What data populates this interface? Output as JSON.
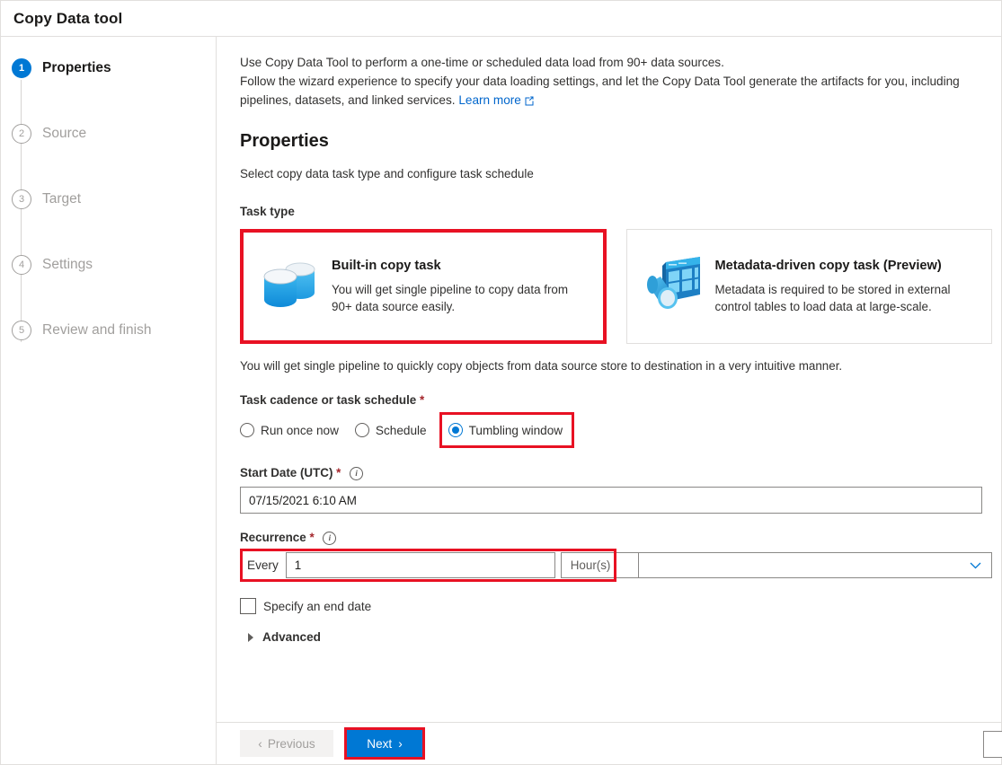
{
  "window": {
    "title": "Copy Data tool"
  },
  "sidebar": {
    "steps": [
      {
        "num": "1",
        "label": "Properties",
        "state": "active"
      },
      {
        "num": "2",
        "label": "Source",
        "state": "inactive"
      },
      {
        "num": "3",
        "label": "Target",
        "state": "inactive"
      },
      {
        "num": "4",
        "label": "Settings",
        "state": "inactive"
      },
      {
        "num": "5",
        "label": "Review and finish",
        "state": "inactive"
      }
    ]
  },
  "intro": {
    "line1": "Use Copy Data Tool to perform a one-time or scheduled data load from 90+ data sources.",
    "line2": "Follow the wizard experience to specify your data loading settings, and let the Copy Data Tool generate the artifacts for you, including pipelines, datasets, and linked services.",
    "learn_more": "Learn more"
  },
  "page": {
    "title": "Properties",
    "subtitle": "Select copy data task type and configure task schedule"
  },
  "task_type": {
    "label": "Task type",
    "cards": [
      {
        "title": "Built-in copy task",
        "desc": "You will get single pipeline to copy data from 90+ data source easily.",
        "icon": "database-copy-icon",
        "selected": true
      },
      {
        "title": "Metadata-driven copy task (Preview)",
        "desc": "Metadata is required to be stored in external control tables to load data at large-scale.",
        "icon": "metadata-table-icon",
        "selected": false
      }
    ],
    "note": "You will get single pipeline to quickly copy objects from data source store to destination in a very intuitive manner."
  },
  "cadence": {
    "label": "Task cadence or task schedule",
    "required_mark": "*",
    "options": [
      {
        "label": "Run once now",
        "checked": false,
        "highlighted": false
      },
      {
        "label": "Schedule",
        "checked": false,
        "highlighted": false
      },
      {
        "label": "Tumbling window",
        "checked": true,
        "highlighted": true
      }
    ]
  },
  "start_date": {
    "label": "Start Date (UTC)",
    "required_mark": "*",
    "info_glyph": "i",
    "value": "07/15/2021 6:10 AM"
  },
  "recurrence": {
    "label": "Recurrence",
    "required_mark": "*",
    "info_glyph": "i",
    "every_label": "Every",
    "value": "1",
    "unit": "Hour(s)",
    "chevron": "⌄"
  },
  "end_date": {
    "label": "Specify an end date",
    "checked": false
  },
  "advanced": {
    "label": "Advanced",
    "expanded": false
  },
  "footer": {
    "previous_label": "Previous",
    "previous_chevron": "‹",
    "next_label": "Next",
    "next_chevron": "›"
  },
  "colors": {
    "accent": "#0078d4",
    "highlight": "#e81123",
    "link": "#0066cc"
  }
}
